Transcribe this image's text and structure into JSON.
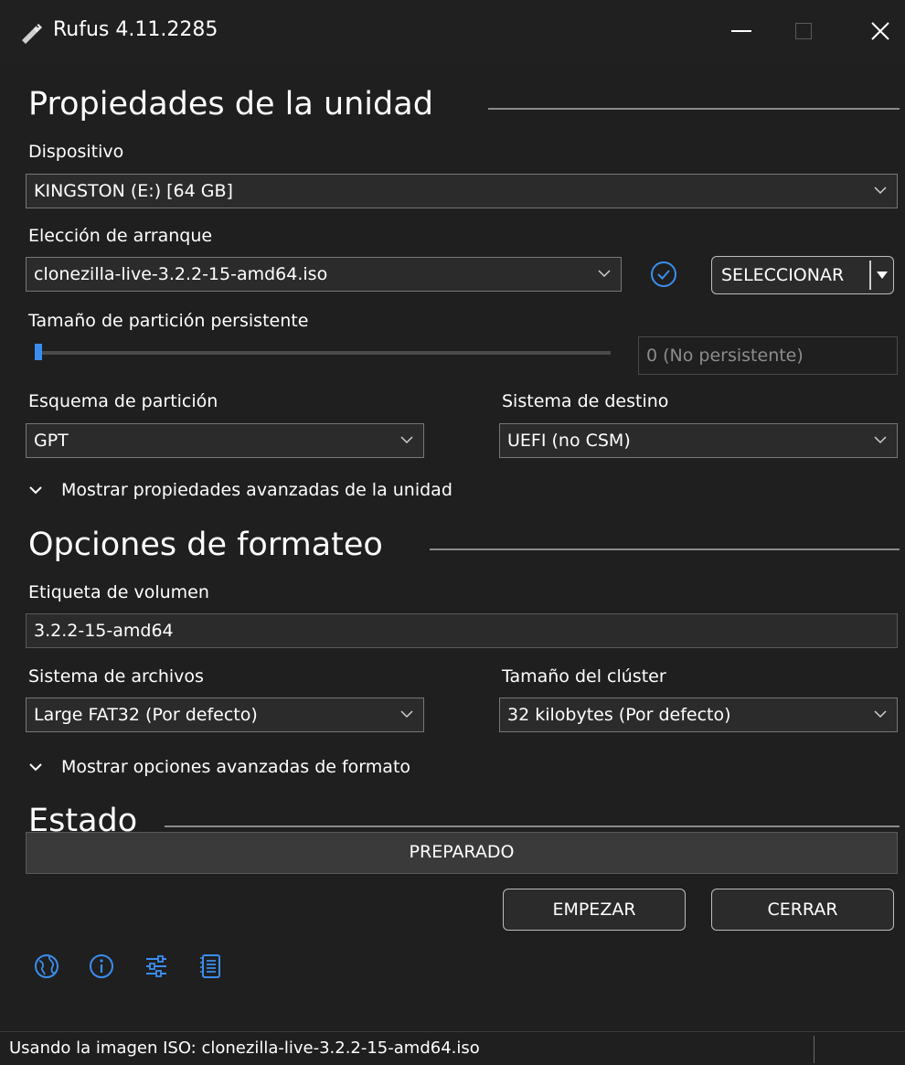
{
  "window": {
    "title": "Rufus 4.11.2285",
    "icon": "usb-drive-icon"
  },
  "drive_properties": {
    "heading": "Propiedades de la unidad",
    "device": {
      "label": "Dispositivo",
      "value": "KINGSTON (E:) [64 GB]"
    },
    "boot_selection": {
      "label": "Elección de arranque",
      "value": "clonezilla-live-3.2.2-15-amd64.iso",
      "verify_icon": "check-circle-icon"
    },
    "select_button": {
      "label": "SELECCIONAR"
    },
    "persistent": {
      "label": "Tamaño de partición persistente",
      "slider_value": 0,
      "value_text": "0 (No persistente)"
    },
    "partition_scheme": {
      "label": "Esquema de partición",
      "value": "GPT"
    },
    "target_system": {
      "label": "Sistema de destino",
      "value": "UEFI (no CSM)"
    },
    "advanced_toggle": "Mostrar propiedades avanzadas de la unidad"
  },
  "format_options": {
    "heading": "Opciones de formateo",
    "volume_label": {
      "label": "Etiqueta de volumen",
      "value": "3.2.2-15-amd64"
    },
    "file_system": {
      "label": "Sistema de archivos",
      "value": "Large FAT32 (Por defecto)"
    },
    "cluster_size": {
      "label": "Tamaño del clúster",
      "value": "32 kilobytes (Por defecto)"
    },
    "advanced_toggle": "Mostrar opciones avanzadas de formato"
  },
  "status": {
    "heading": "Estado",
    "progress_text": "PREPARADO",
    "progress_fraction": 0
  },
  "toolbar": {
    "icons": [
      "globe-icon",
      "info-icon",
      "settings-sliders-icon",
      "log-icon"
    ],
    "accent_color": "#3b8ef0"
  },
  "actions": {
    "start_label": "EMPEZAR",
    "close_label": "CERRAR"
  },
  "statusbar": {
    "text": "Usando la imagen ISO: clonezilla-live-3.2.2-15-amd64.iso"
  }
}
